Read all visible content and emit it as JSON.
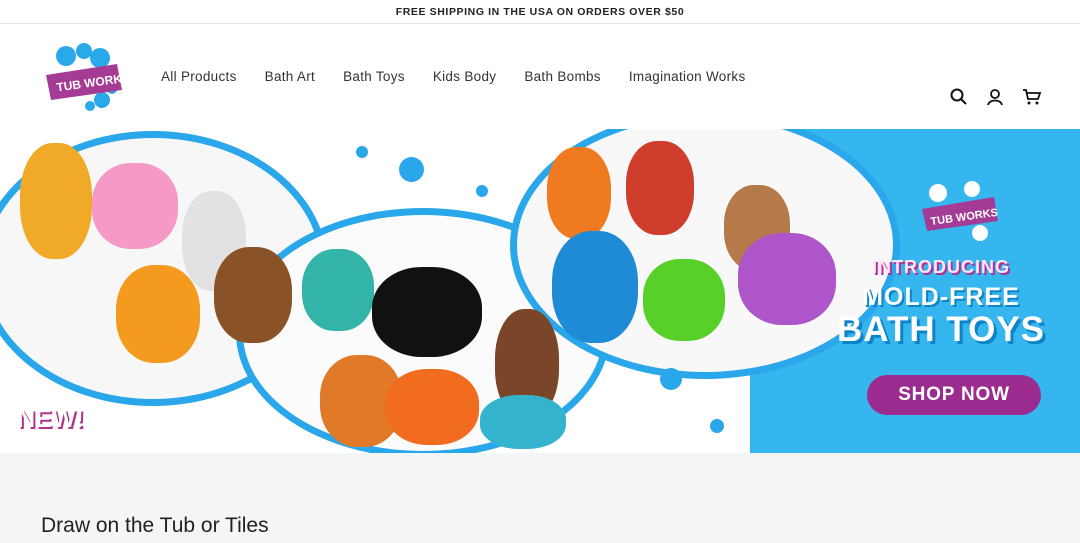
{
  "announcement": "FREE SHIPPING IN THE USA ON ORDERS OVER $50",
  "logo_text": "TUB WORKS",
  "nav": [
    "All Products",
    "Bath Art",
    "Bath Toys",
    "Kids Body",
    "Bath Bombs",
    "Imagination Works"
  ],
  "icons": [
    "search-icon",
    "account-icon",
    "cart-icon"
  ],
  "hero": {
    "badge": "NEW!",
    "introducing": "INTRODUCING",
    "mold_free": "MOLD-FREE",
    "bath_toys": "BATH TOYS",
    "button": "SHOP NOW"
  },
  "section_title": "Draw on the Tub or Tiles",
  "colors": {
    "blue": "#35b6ee",
    "purple": "#9b2b8f"
  }
}
